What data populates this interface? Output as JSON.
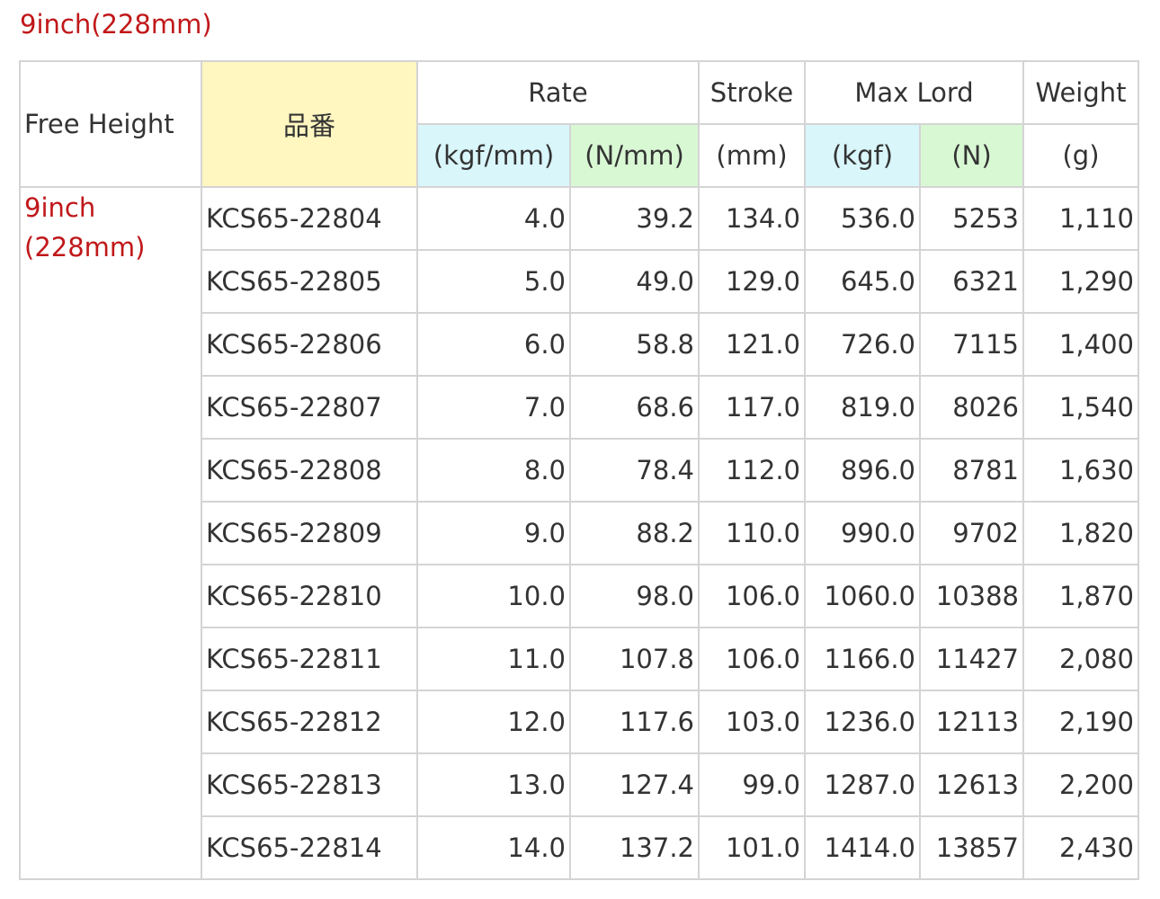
{
  "title": "9inch(228mm)",
  "header": {
    "free_height": "Free Height",
    "part_no": "品番",
    "rate": "Rate",
    "stroke": "Stroke",
    "max_lord": "Max Lord",
    "weight": "Weight",
    "units": {
      "rate_kgf": "(kgf/mm)",
      "rate_n": "(N/mm)",
      "stroke": "(mm)",
      "max_kgf": "(kgf)",
      "max_n": "(N)",
      "weight": "(g)"
    }
  },
  "colors": {
    "title_red": "#c0181a",
    "part_header_yellow": "#fff6c0",
    "unit_blue": "#d9f6fb",
    "unit_green": "#d8f8d4",
    "border_grey": "#d4d4d4"
  },
  "group": {
    "line1": "9inch",
    "line2": "(228mm)"
  },
  "rows": [
    {
      "part": "KCS65-22804",
      "rate_kgf": "4.0",
      "rate_n": "39.2",
      "stroke": "134.0",
      "max_kgf": "536.0",
      "max_n": "5253",
      "weight": "1,110"
    },
    {
      "part": "KCS65-22805",
      "rate_kgf": "5.0",
      "rate_n": "49.0",
      "stroke": "129.0",
      "max_kgf": "645.0",
      "max_n": "6321",
      "weight": "1,290"
    },
    {
      "part": "KCS65-22806",
      "rate_kgf": "6.0",
      "rate_n": "58.8",
      "stroke": "121.0",
      "max_kgf": "726.0",
      "max_n": "7115",
      "weight": "1,400"
    },
    {
      "part": "KCS65-22807",
      "rate_kgf": "7.0",
      "rate_n": "68.6",
      "stroke": "117.0",
      "max_kgf": "819.0",
      "max_n": "8026",
      "weight": "1,540"
    },
    {
      "part": "KCS65-22808",
      "rate_kgf": "8.0",
      "rate_n": "78.4",
      "stroke": "112.0",
      "max_kgf": "896.0",
      "max_n": "8781",
      "weight": "1,630"
    },
    {
      "part": "KCS65-22809",
      "rate_kgf": "9.0",
      "rate_n": "88.2",
      "stroke": "110.0",
      "max_kgf": "990.0",
      "max_n": "9702",
      "weight": "1,820"
    },
    {
      "part": "KCS65-22810",
      "rate_kgf": "10.0",
      "rate_n": "98.0",
      "stroke": "106.0",
      "max_kgf": "1060.0",
      "max_n": "10388",
      "weight": "1,870"
    },
    {
      "part": "KCS65-22811",
      "rate_kgf": "11.0",
      "rate_n": "107.8",
      "stroke": "106.0",
      "max_kgf": "1166.0",
      "max_n": "11427",
      "weight": "2,080"
    },
    {
      "part": "KCS65-22812",
      "rate_kgf": "12.0",
      "rate_n": "117.6",
      "stroke": "103.0",
      "max_kgf": "1236.0",
      "max_n": "12113",
      "weight": "2,190"
    },
    {
      "part": "KCS65-22813",
      "rate_kgf": "13.0",
      "rate_n": "127.4",
      "stroke": "99.0",
      "max_kgf": "1287.0",
      "max_n": "12613",
      "weight": "2,200"
    },
    {
      "part": "KCS65-22814",
      "rate_kgf": "14.0",
      "rate_n": "137.2",
      "stroke": "101.0",
      "max_kgf": "1414.0",
      "max_n": "13857",
      "weight": "2,430"
    }
  ]
}
